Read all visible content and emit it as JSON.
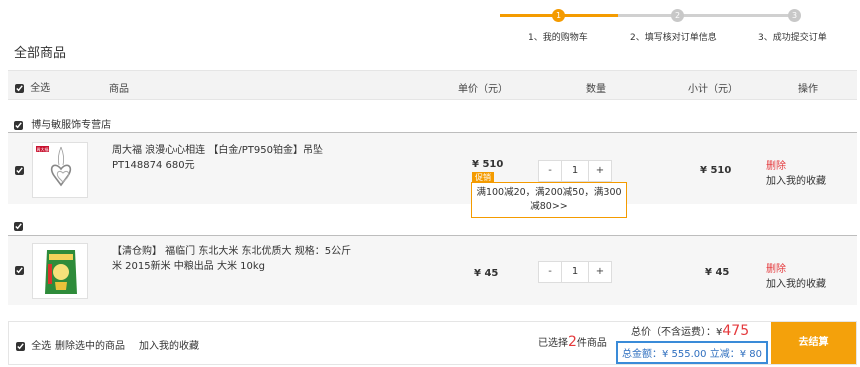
{
  "steps": [
    {
      "num": "1",
      "label": "1、我的购物车",
      "active": true
    },
    {
      "num": "2",
      "label": "2、填写核对订单信息",
      "active": false
    },
    {
      "num": "3",
      "label": "3、成功提交订单",
      "active": false
    }
  ],
  "page_title": "全部商品",
  "header": {
    "select_all": "全选",
    "product": "商品",
    "unit_price": "单价（元）",
    "quantity": "数量",
    "subtotal": "小计（元）",
    "operation": "操作"
  },
  "store": {
    "name": "博与敏服饰专营店"
  },
  "items": [
    {
      "name": "周大福 浪漫心心相连 【白金/PT950铂金】吊坠 PT148874 680元",
      "price": "¥ 510",
      "promo_badge": "促销",
      "promo_text": "满100减20，满200减50，满300减80>>",
      "qty_minus": "-",
      "qty": "1",
      "qty_plus": "+",
      "subtotal": "¥ 510",
      "delete": "删除",
      "favorite": "加入我的收藏",
      "thumb_logo": "周大福"
    },
    {
      "name": "【清仓购】 福临门 东北大米 东北优质大 规格：5公斤 米 2015新米 中粮出品 大米 10kg",
      "price": "¥ 45",
      "qty_minus": "-",
      "qty": "1",
      "qty_plus": "+",
      "subtotal": "¥ 45",
      "delete": "删除",
      "favorite": "加入我的收藏"
    }
  ],
  "footer": {
    "select_all": "全选",
    "delete_selected": "删除选中的商品",
    "add_favorite": "加入我的收藏",
    "selected_prefix": "已选择",
    "selected_count": "2",
    "selected_suffix": "件商品",
    "total_label": "总价（不含运费）：¥",
    "total_value": "475",
    "summary": "总金额：¥ 555.00 立减：¥ 80",
    "checkout": "去结算"
  },
  "colors": {
    "accent": "#f49b00",
    "step_inactive": "#d0d0d0",
    "price_red": "#e4393c",
    "summary_border": "#3a8bd8"
  }
}
